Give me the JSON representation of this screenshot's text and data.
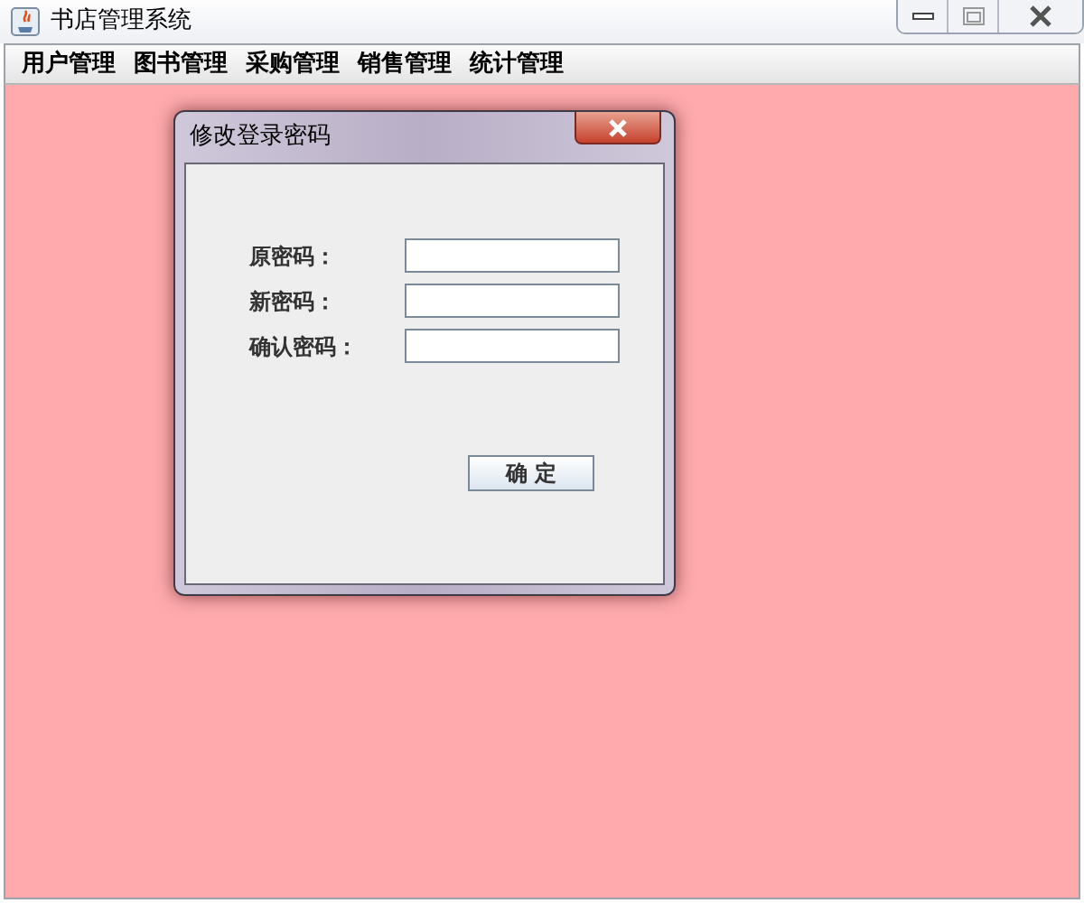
{
  "window": {
    "title": "书店管理系统"
  },
  "menu": [
    {
      "label": "用户管理"
    },
    {
      "label": "图书管理"
    },
    {
      "label": "采购管理"
    },
    {
      "label": "销售管理"
    },
    {
      "label": "统计管理"
    }
  ],
  "dialog": {
    "title": "修改登录密码",
    "fields": [
      {
        "label": "原密码："
      },
      {
        "label": "新密码："
      },
      {
        "label": "确认密码："
      }
    ],
    "button": "确 定"
  }
}
